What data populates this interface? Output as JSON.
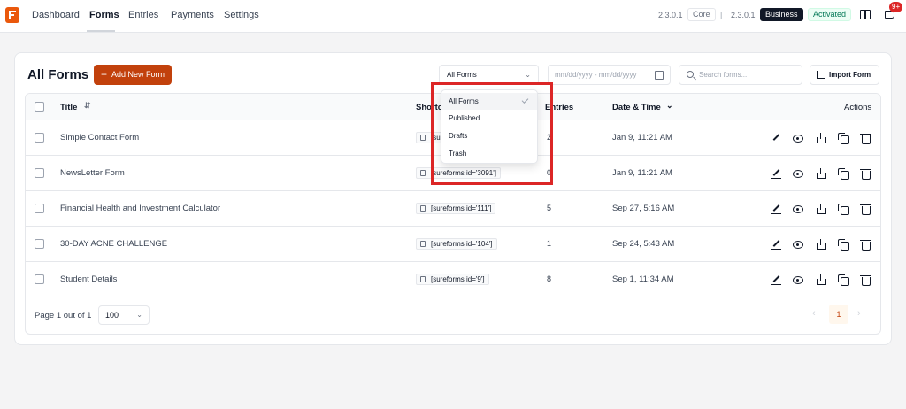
{
  "nav": {
    "items": [
      "Dashboard",
      "Forms",
      "Entries",
      "Payments",
      "Settings"
    ],
    "active": "Forms",
    "version_core": "2.3.0.1",
    "core_label": "Core",
    "separator": "|",
    "version_business": "2.3.0.1",
    "business_label": "Business",
    "activated_label": "Activated",
    "notification_count": "9+"
  },
  "header": {
    "title": "All Forms",
    "add_button": "Add New Form",
    "status_filter": "All Forms",
    "date_placeholder": "mm/dd/yyyy - mm/dd/yyyy",
    "search_placeholder": "Search forms...",
    "import_button": "Import Form"
  },
  "table": {
    "columns": {
      "title": "Title",
      "shortcode": "Shortcode",
      "entries": "Entries",
      "date": "Date & Time",
      "actions": "Actions"
    },
    "rows": [
      {
        "title": "Simple Contact Form",
        "shortcode": "[sureforms id='3092']",
        "entries": "2",
        "date": "Jan 9, 11:21 AM"
      },
      {
        "title": "NewsLetter Form",
        "shortcode": "[sureforms id='3091']",
        "entries": "0",
        "date": "Jan 9, 11:21 AM"
      },
      {
        "title": "Financial Health and Investment Calculator",
        "shortcode": "[sureforms id='111']",
        "entries": "5",
        "date": "Sep 27, 5:16 AM"
      },
      {
        "title": "30-DAY ACNE CHALLENGE",
        "shortcode": "[sureforms id='104']",
        "entries": "1",
        "date": "Sep 24, 5:43 AM"
      },
      {
        "title": "Student Details",
        "shortcode": "[sureforms id='9']",
        "entries": "8",
        "date": "Sep 1, 11:34 AM"
      }
    ]
  },
  "footer": {
    "page_text": "Page 1 out of 1",
    "per_page": "100",
    "current_page": "1",
    "prev": "‹",
    "next": "›"
  },
  "dropdown": {
    "options": [
      "All Forms",
      "Published",
      "Drafts",
      "Trash"
    ],
    "selected": "All Forms"
  },
  "colors": {
    "accent": "#c2410c",
    "highlight": "#dc2626"
  }
}
